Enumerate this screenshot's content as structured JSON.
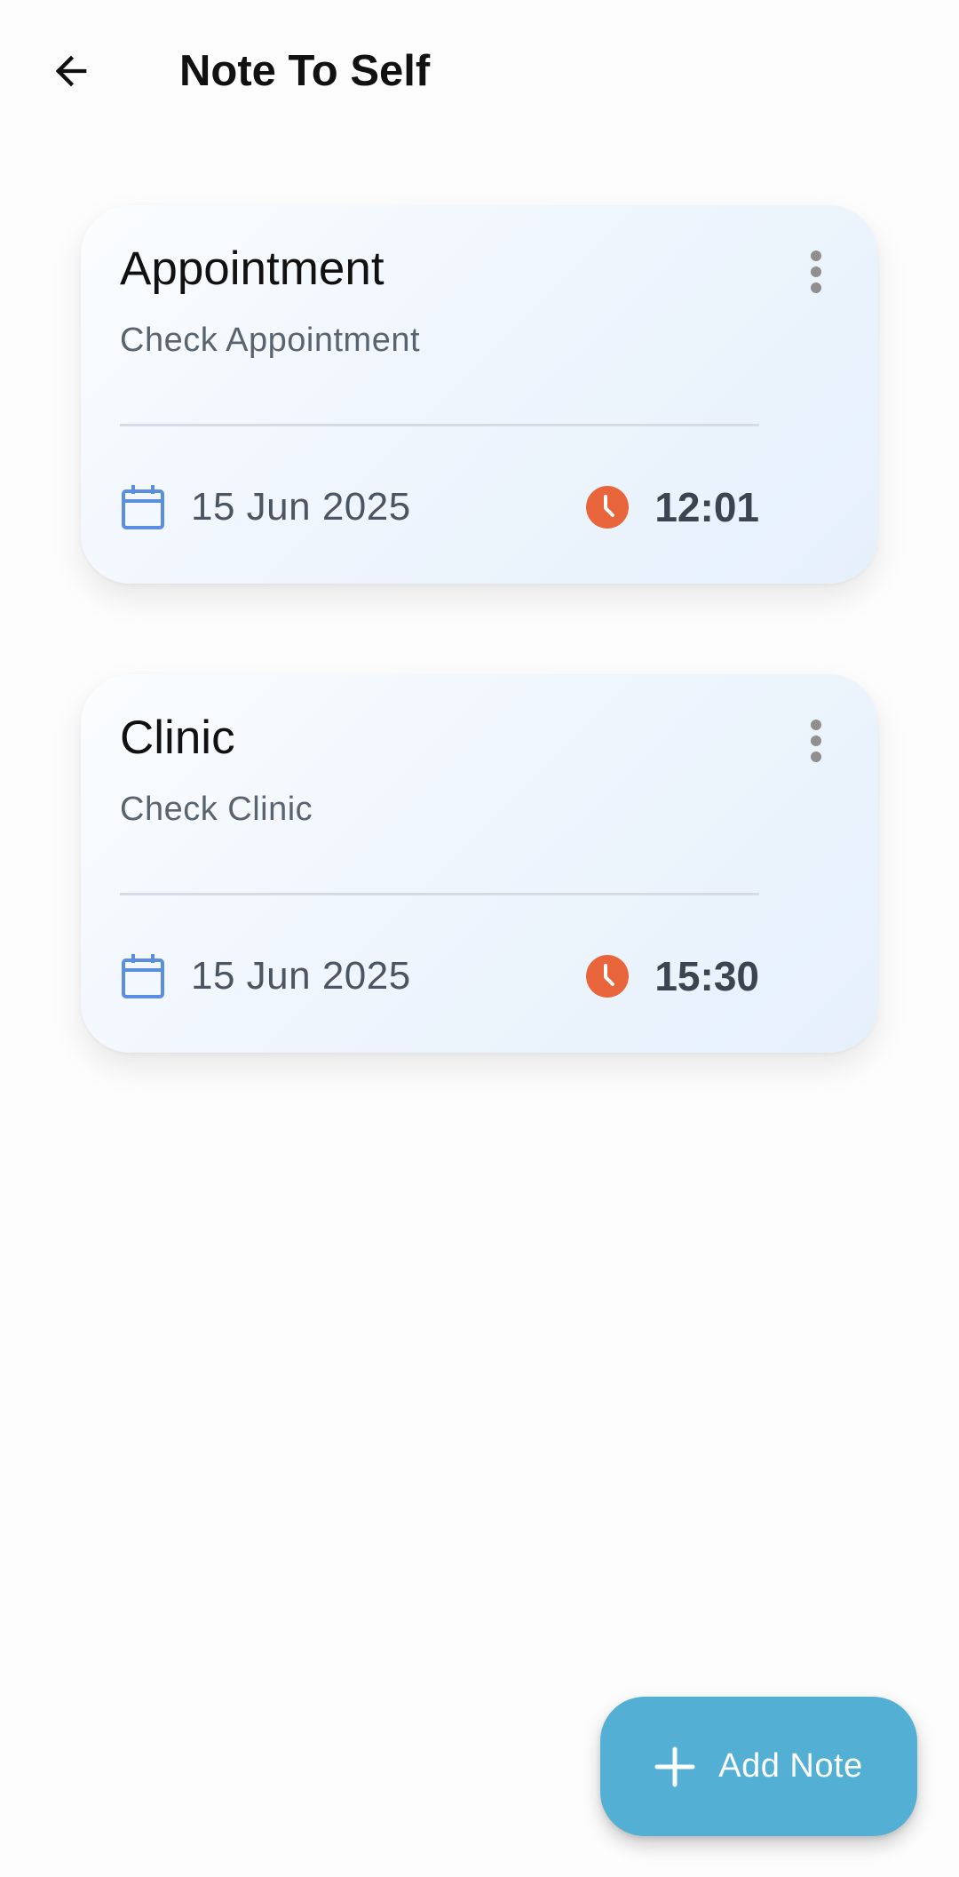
{
  "header": {
    "title": "Note To Self",
    "back_icon": "arrow-left-icon"
  },
  "notes": [
    {
      "title": "Appointment",
      "subtitle": "Check Appointment",
      "date": "15 Jun 2025",
      "time": "12:01"
    },
    {
      "title": "Clinic",
      "subtitle": "Check Clinic",
      "date": "15 Jun 2025",
      "time": "15:30"
    }
  ],
  "fab": {
    "label": "Add Note",
    "icon": "plus-icon"
  },
  "colors": {
    "accent": "#53b0d4",
    "calendar_icon": "#5b8de0",
    "clock_icon": "#e8643b"
  }
}
